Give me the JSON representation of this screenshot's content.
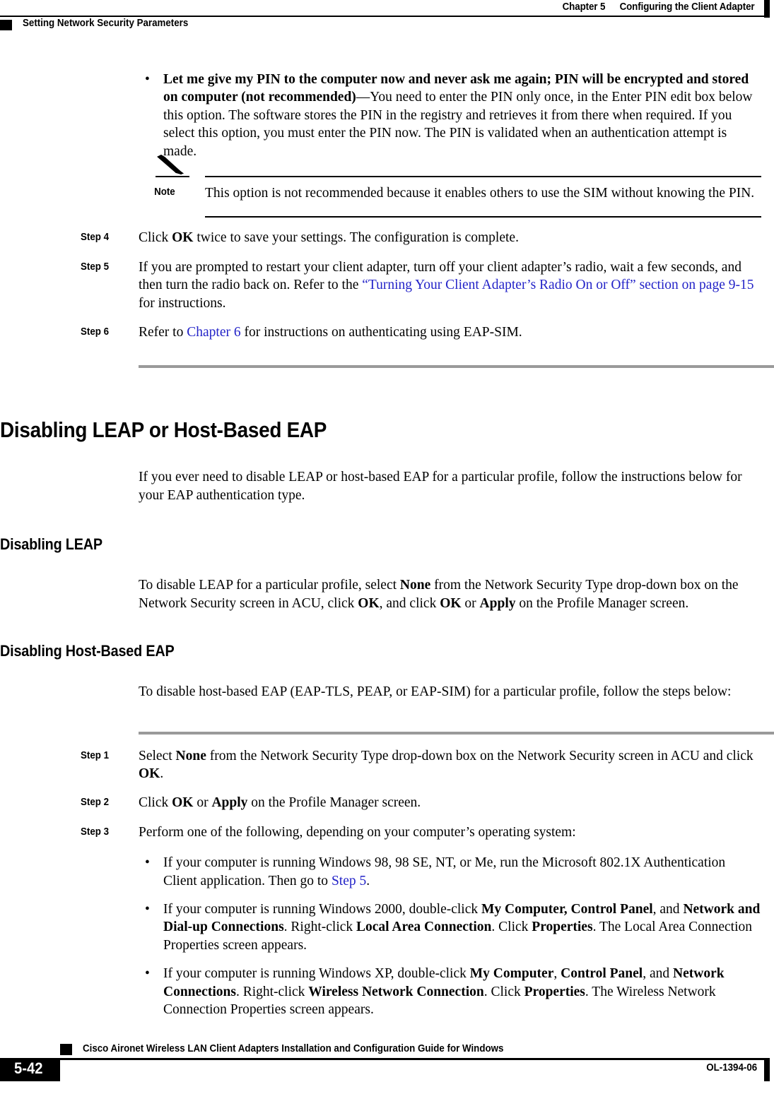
{
  "header": {
    "chapter_number": "Chapter 5",
    "chapter_title": "Configuring the Client Adapter",
    "running_head": "Setting Network Security Parameters"
  },
  "top_bullet": {
    "bullet_glyph": "•",
    "bold_lead": "Let me give my PIN to the computer now and never ask me again; PIN will be encrypted and stored on computer (not recommended)",
    "rest": "—You need to enter the PIN only once, in the Enter PIN edit box below this option. The software stores the PIN in the registry and retrieves it from there when required. If you select this option, you must enter the PIN now. The PIN is validated when an authentication attempt is made."
  },
  "note": {
    "label": "Note",
    "icon": "pencil-icon",
    "text": "This option is not recommended because it enables others to use the SIM without knowing the PIN."
  },
  "steps_eapsim": [
    {
      "label": "Step 4",
      "parts": [
        {
          "t": "Click ",
          "s": "plain"
        },
        {
          "t": "OK",
          "s": "bold"
        },
        {
          "t": " twice to save your settings. The configuration is complete.",
          "s": "plain"
        }
      ]
    },
    {
      "label": "Step 5",
      "parts": [
        {
          "t": "If you are prompted to restart your client adapter, turn off your client adapter’s radio, wait a few seconds, and then turn the radio back on. Refer to the ",
          "s": "plain"
        },
        {
          "t": "“Turning Your Client Adapter’s Radio On or Off” section on page 9-15",
          "s": "link"
        },
        {
          "t": " for instructions.",
          "s": "plain"
        }
      ]
    },
    {
      "label": "Step 6",
      "parts": [
        {
          "t": "Refer to ",
          "s": "plain"
        },
        {
          "t": "Chapter 6",
          "s": "link"
        },
        {
          "t": " for instructions on authenticating using EAP-SIM.",
          "s": "plain"
        }
      ]
    }
  ],
  "section": {
    "title": "Disabling LEAP or Host-Based EAP",
    "intro": "If you ever need to disable LEAP or host-based EAP for a particular profile, follow the instructions below for your EAP authentication type."
  },
  "subsection_leap": {
    "title": "Disabling LEAP",
    "parts": [
      {
        "t": "To disable LEAP for a particular profile, select ",
        "s": "plain"
      },
      {
        "t": "None",
        "s": "bold"
      },
      {
        "t": " from the Network Security Type drop-down box on the Network Security screen in ACU, click ",
        "s": "plain"
      },
      {
        "t": "OK",
        "s": "bold"
      },
      {
        "t": ", and click ",
        "s": "plain"
      },
      {
        "t": "OK",
        "s": "bold"
      },
      {
        "t": " or ",
        "s": "plain"
      },
      {
        "t": "Apply",
        "s": "bold"
      },
      {
        "t": " on the Profile Manager screen.",
        "s": "plain"
      }
    ]
  },
  "subsection_hosteap": {
    "title": "Disabling Host-Based EAP",
    "intro": "To disable host-based EAP (EAP-TLS, PEAP, or EAP-SIM) for a particular profile, follow the steps below:"
  },
  "steps_hosteap": [
    {
      "label": "Step 1",
      "parts": [
        {
          "t": "Select ",
          "s": "plain"
        },
        {
          "t": "None",
          "s": "bold"
        },
        {
          "t": " from the Network Security Type drop-down box on the Network Security screen in ACU and click ",
          "s": "plain"
        },
        {
          "t": "OK",
          "s": "bold"
        },
        {
          "t": ".",
          "s": "plain"
        }
      ]
    },
    {
      "label": "Step 2",
      "parts": [
        {
          "t": "Click ",
          "s": "plain"
        },
        {
          "t": "OK",
          "s": "bold"
        },
        {
          "t": " or ",
          "s": "plain"
        },
        {
          "t": "Apply",
          "s": "bold"
        },
        {
          "t": " on the Profile Manager screen.",
          "s": "plain"
        }
      ]
    },
    {
      "label": "Step 3",
      "parts": [
        {
          "t": "Perform one of the following, depending on your computer’s operating system:",
          "s": "plain"
        }
      ]
    }
  ],
  "os_bullets": [
    {
      "glyph": "•",
      "parts": [
        {
          "t": "If your computer is running Windows 98, 98 SE, NT, or Me, run the Microsoft 802.1X Authentication Client application. Then go to  ",
          "s": "plain"
        },
        {
          "t": "Step 5",
          "s": "link"
        },
        {
          "t": ".",
          "s": "plain"
        }
      ]
    },
    {
      "glyph": "•",
      "parts": [
        {
          "t": "If your computer is running Windows 2000, double-click ",
          "s": "plain"
        },
        {
          "t": "My Computer, Control Panel",
          "s": "bold"
        },
        {
          "t": ", and ",
          "s": "plain"
        },
        {
          "t": "Network and Dial-up Connections",
          "s": "bold"
        },
        {
          "t": ". Right-click ",
          "s": "plain"
        },
        {
          "t": "Local Area Connection",
          "s": "bold"
        },
        {
          "t": ". Click ",
          "s": "plain"
        },
        {
          "t": "Properties",
          "s": "bold"
        },
        {
          "t": ". The Local Area Connection Properties screen appears.",
          "s": "plain"
        }
      ]
    },
    {
      "glyph": "•",
      "parts": [
        {
          "t": "If your computer is running Windows XP, double-click ",
          "s": "plain"
        },
        {
          "t": "My Computer",
          "s": "bold"
        },
        {
          "t": ", ",
          "s": "plain"
        },
        {
          "t": "Control Panel",
          "s": "bold"
        },
        {
          "t": ", and ",
          "s": "plain"
        },
        {
          "t": "Network Connections",
          "s": "bold"
        },
        {
          "t": ". Right-click ",
          "s": "plain"
        },
        {
          "t": "Wireless Network Connection",
          "s": "bold"
        },
        {
          "t": ". Click ",
          "s": "plain"
        },
        {
          "t": "Properties",
          "s": "bold"
        },
        {
          "t": ". The Wireless Network Connection Properties screen appears.",
          "s": "plain"
        }
      ]
    }
  ],
  "footer": {
    "guide_title": "Cisco Aironet Wireless LAN Client Adapters Installation and Configuration Guide for Windows",
    "page_number": "5-42",
    "doc_number": "OL-1394-06"
  },
  "colors": {
    "link": "#2323c8",
    "rule_gray": "#9a9a9a",
    "ink": "#000000"
  }
}
